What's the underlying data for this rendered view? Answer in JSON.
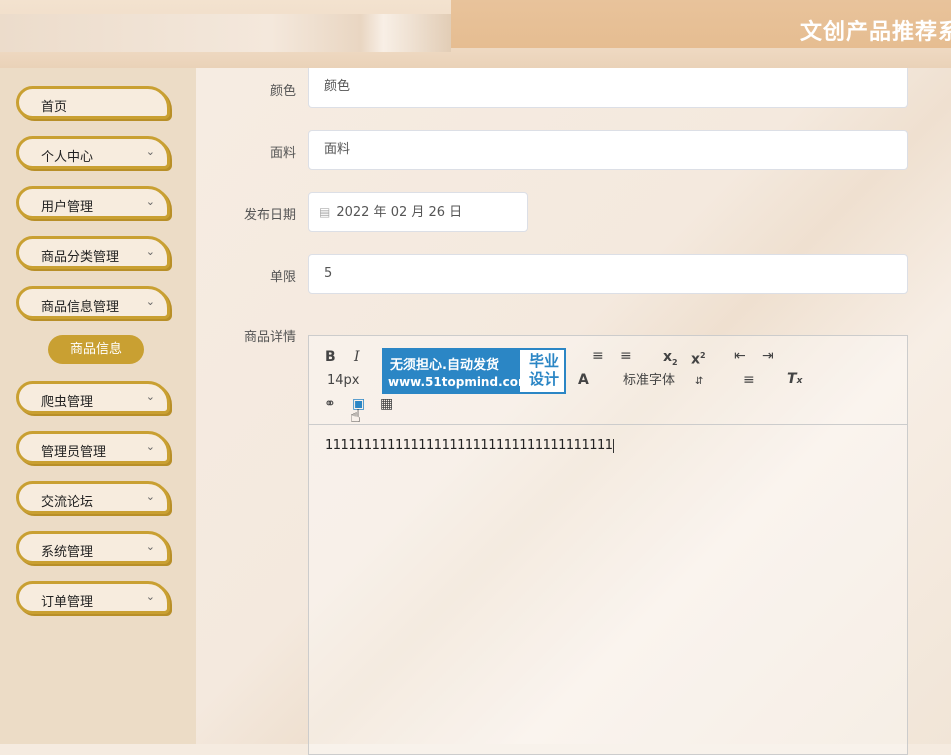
{
  "header": {
    "title": "文创产品推荐系"
  },
  "sidebar": {
    "items": [
      {
        "label": "首页",
        "chevron": ""
      },
      {
        "label": "个人中心",
        "chevron": "chevron-down-icon"
      },
      {
        "label": "用户管理",
        "chevron": "chevron-down-icon"
      },
      {
        "label": "商品分类管理",
        "chevron": "chevron-down-icon"
      },
      {
        "label": "商品信息管理",
        "chevron": "chevron-down-icon"
      },
      {
        "label": "爬虫管理",
        "chevron": "chevron-down-icon"
      },
      {
        "label": "管理员管理",
        "chevron": "chevron-down-icon"
      },
      {
        "label": "交流论坛",
        "chevron": "chevron-down-icon"
      },
      {
        "label": "系统管理",
        "chevron": "chevron-down-icon"
      },
      {
        "label": "订单管理",
        "chevron": "chevron-down-icon"
      }
    ],
    "active_sub": "商品信息"
  },
  "form": {
    "color": {
      "label": "颜色",
      "value": "颜色"
    },
    "fabric": {
      "label": "面料",
      "value": "面料"
    },
    "publish_date": {
      "label": "发布日期",
      "value": "2022 年 02 月 26 日"
    },
    "limit": {
      "label": "单限",
      "value": "5"
    },
    "detail": {
      "label": "商品详情"
    }
  },
  "editor": {
    "font_size": "14px",
    "font_family": "标准字体",
    "content": "1111111111111111111111111111111111111"
  },
  "watermark": {
    "line1": "无须担心.自动发货",
    "line2": "www.51topmind.com",
    "right1": "毕业",
    "right2": "设计"
  },
  "colors": {
    "accent": "#c9a032",
    "watermark": "#2b86c5"
  }
}
